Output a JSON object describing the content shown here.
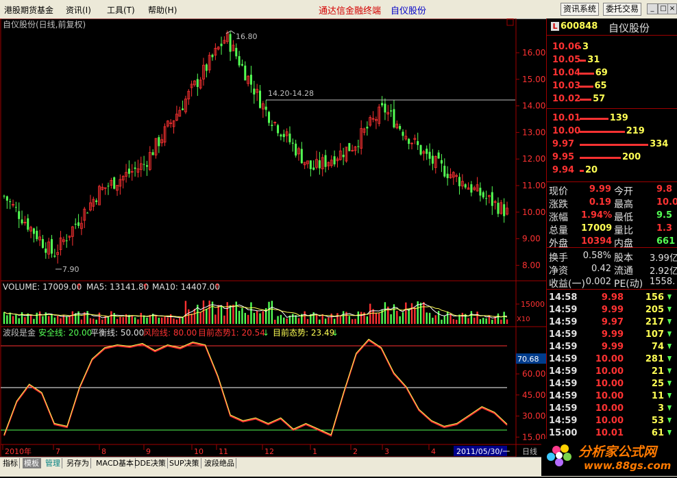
{
  "menu": {
    "items": [
      "港股期货基金",
      "资讯(I)",
      "工具(T)",
      "帮助(H)"
    ],
    "brand": "通达信金融终端",
    "stock_title": "自仪股份",
    "buttons": [
      "资讯系统",
      "委托交易"
    ],
    "window_buttons": [
      "_",
      "□",
      "×"
    ]
  },
  "chart": {
    "title": "自仪股份(日线,前复权)",
    "price_labels": {
      "high": "16.80",
      "low": "7.90",
      "range": "14.20-14.28"
    },
    "price_axis": [
      "16.00",
      "15.00",
      "14.00",
      "13.00",
      "12.00",
      "11.00",
      "10.00",
      "9.00",
      "8.00"
    ],
    "volume_header": {
      "label": "VOLUME: 17009.00",
      "ma5": "MA5: 13141.80",
      "ma10": "MA10: 14407.00"
    },
    "volume_axis": {
      "value": "15000",
      "unit": "X10"
    },
    "indicator_header": {
      "name": "波段是金",
      "safe": "安全线: 20.00",
      "balance": "平衡线: 50.00",
      "risk": "风险线: 80.00",
      "trend1": "目前态势1: 20.54",
      "trend": "目前态势: 23.49"
    },
    "indicator_axis": [
      "70.68",
      "60.00",
      "45.00",
      "30.00",
      "15.00"
    ],
    "date_axis": [
      "2010年",
      "7",
      "8",
      "9",
      "10",
      "11",
      "12",
      "1",
      "2",
      "3",
      "4",
      "2011/05/30/一",
      "日线"
    ],
    "colors": {
      "up": "#ff3232",
      "down": "#54ff54",
      "frame": "#a00000",
      "axis_text": "#ff3232"
    }
  },
  "chart_data": [
    {
      "type": "line",
      "title": "自仪股份(日线,前复权)",
      "xlabel": "",
      "ylabel": "",
      "ylim": [
        7.6,
        17.0
      ],
      "x": [
        "2010-06",
        "2010-07",
        "2010-08",
        "2010-09",
        "2010-10",
        "2010-11",
        "2010-12",
        "2011-01",
        "2011-02",
        "2011-03",
        "2011-04",
        "2011-05-30"
      ],
      "series": [
        {
          "name": "",
          "values": [
            10.6,
            8.4,
            10.8,
            11.8,
            14.6,
            16.6,
            13.8,
            11.6,
            12.5,
            13.9,
            12.0,
            9.99
          ]
        }
      ],
      "annotations": [
        "16.80",
        "7.90",
        "14.20-14.28"
      ]
    },
    {
      "type": "bar",
      "title": "VOLUME: 17009.00",
      "ylim": [
        0,
        25000
      ],
      "series": [
        {
          "name": "MA5",
          "values": [
            13141.8
          ]
        },
        {
          "name": "MA10",
          "values": [
            14407.0
          ]
        }
      ]
    },
    {
      "type": "line",
      "title": "波段是金",
      "ylim": [
        12,
        84
      ],
      "series": [
        {
          "name": "安全线",
          "values": [
            20,
            20
          ]
        },
        {
          "name": "平衡线",
          "values": [
            50,
            50
          ]
        },
        {
          "name": "风险线",
          "values": [
            80,
            80
          ]
        },
        {
          "name": "目前态势",
          "values": [
            16,
            40,
            52,
            46,
            24,
            22,
            50,
            70,
            78,
            80,
            79,
            81,
            76,
            80,
            78,
            82,
            80,
            58,
            30,
            26,
            28,
            24,
            28,
            20,
            24,
            20,
            16,
            46,
            74,
            84,
            78,
            60,
            50,
            34,
            26,
            22,
            24,
            30,
            36,
            32,
            23.49
          ]
        }
      ]
    }
  ],
  "quote": {
    "stock_code": "600848",
    "stock_name": "自仪股份",
    "badge": "L",
    "asks": [
      {
        "price": "10.06",
        "vol": "3"
      },
      {
        "price": "10.05",
        "vol": "31"
      },
      {
        "price": "10.04",
        "vol": "69"
      },
      {
        "price": "10.03",
        "vol": "65"
      },
      {
        "price": "10.02",
        "vol": "57"
      }
    ],
    "bids": [
      {
        "price": "10.01",
        "vol": "139"
      },
      {
        "price": "10.00",
        "vol": "219"
      },
      {
        "price": "9.97",
        "vol": "334"
      },
      {
        "price": "9.95",
        "vol": "200"
      },
      {
        "price": "9.94",
        "vol": "20"
      }
    ],
    "stats": [
      {
        "l1": "现价",
        "v1": "9.99",
        "l2": "今开",
        "v2": "9.8"
      },
      {
        "l1": "涨跌",
        "v1": "0.19",
        "l2": "最高",
        "v2": "10.0"
      },
      {
        "l1": "涨幅",
        "v1": "1.94%",
        "l2": "最低",
        "v2": "9.5"
      },
      {
        "l1": "总量",
        "v1": "17009",
        "l2": "量比",
        "v2": "1.3"
      },
      {
        "l1": "外盘",
        "v1": "10394",
        "l2": "内盘",
        "v2": "661"
      }
    ],
    "fundamentals": [
      {
        "l1": "换手",
        "v1": "0.58%",
        "l2": "股本",
        "v2": "3.99亿"
      },
      {
        "l1": "净资",
        "v1": "0.42",
        "l2": "流通",
        "v2": "2.92亿"
      },
      {
        "l1": "收益(一)",
        "v1": "0.002",
        "l2": "PE(动)",
        "v2": "1558."
      }
    ],
    "ticks": [
      {
        "time": "14:58",
        "price": "9.98",
        "vol": "156",
        "dir": "down"
      },
      {
        "time": "14:59",
        "price": "9.99",
        "vol": "205",
        "dir": "down"
      },
      {
        "time": "14:59",
        "price": "9.97",
        "vol": "217",
        "dir": "down"
      },
      {
        "time": "14:59",
        "price": "9.99",
        "vol": "107",
        "dir": "down"
      },
      {
        "time": "14:59",
        "price": "9.99",
        "vol": "74",
        "dir": "down"
      },
      {
        "time": "14:59",
        "price": "10.00",
        "vol": "281",
        "dir": "down"
      },
      {
        "time": "14:59",
        "price": "10.00",
        "vol": "21",
        "dir": "down"
      },
      {
        "time": "14:59",
        "price": "10.00",
        "vol": "25",
        "dir": "down"
      },
      {
        "time": "14:59",
        "price": "10.00",
        "vol": "11",
        "dir": "down"
      },
      {
        "time": "14:59",
        "price": "10.00",
        "vol": "3",
        "dir": "down"
      },
      {
        "time": "14:59",
        "price": "10.00",
        "vol": "53",
        "dir": "down"
      },
      {
        "time": "15:00",
        "price": "10.01",
        "vol": "61",
        "dir": "down"
      }
    ]
  },
  "bottom_tabs": [
    "指标",
    "模板",
    "管理",
    "另存为",
    "MACD基本",
    "DDE决策",
    "SUP决策",
    "波段绝品"
  ],
  "watermark": {
    "name": "分析家公式网",
    "url": "www.88gs.com"
  }
}
